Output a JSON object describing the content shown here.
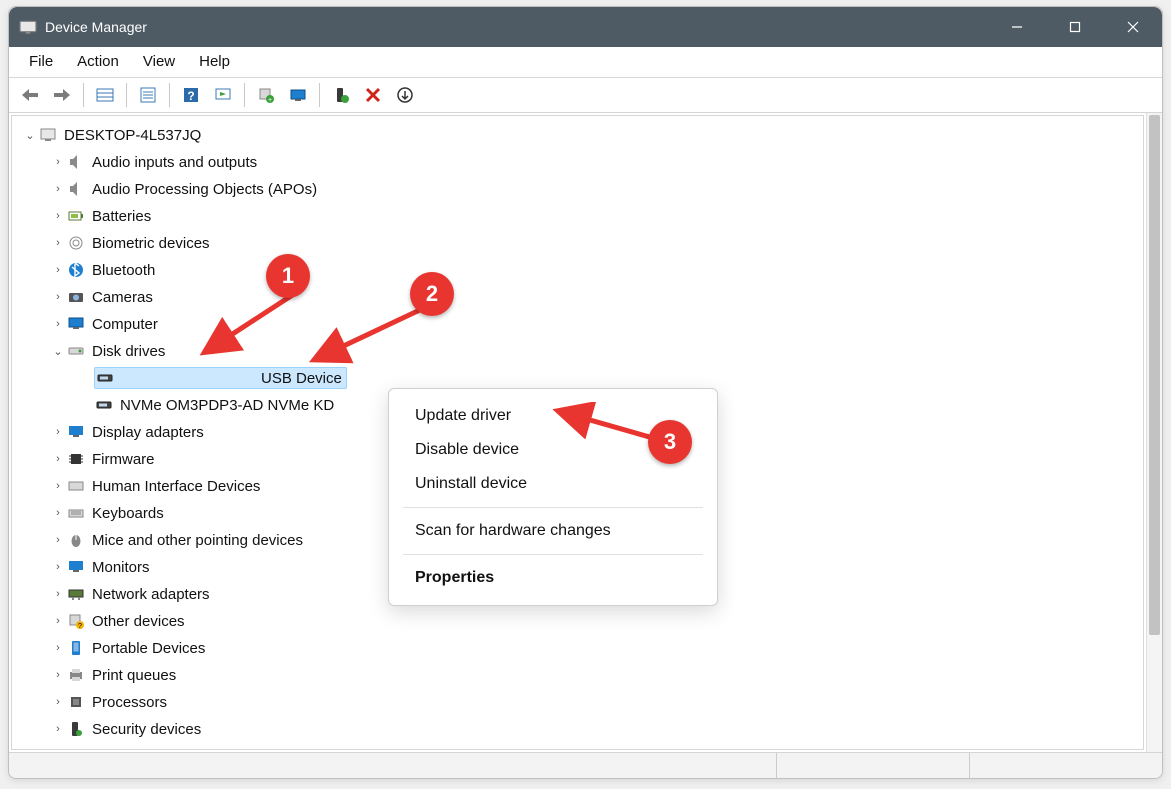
{
  "window": {
    "title": "Device Manager"
  },
  "menu": {
    "file": "File",
    "action": "Action",
    "view": "View",
    "help": "Help"
  },
  "tree": {
    "root": "DESKTOP-4L537JQ",
    "items": [
      {
        "label": "Audio inputs and outputs"
      },
      {
        "label": "Audio Processing Objects (APOs)"
      },
      {
        "label": "Batteries"
      },
      {
        "label": "Biometric devices"
      },
      {
        "label": "Bluetooth"
      },
      {
        "label": "Cameras"
      },
      {
        "label": "Computer"
      },
      {
        "label": "Disk drives",
        "expanded": true,
        "children": [
          {
            "label": "USB Device",
            "selected": true
          },
          {
            "label": "NVMe OM3PDP3-AD NVMe KD"
          }
        ]
      },
      {
        "label": "Display adapters"
      },
      {
        "label": "Firmware"
      },
      {
        "label": "Human Interface Devices"
      },
      {
        "label": "Keyboards"
      },
      {
        "label": "Mice and other pointing devices"
      },
      {
        "label": "Monitors"
      },
      {
        "label": "Network adapters"
      },
      {
        "label": "Other devices"
      },
      {
        "label": "Portable Devices"
      },
      {
        "label": "Print queues"
      },
      {
        "label": "Processors"
      },
      {
        "label": "Security devices"
      }
    ]
  },
  "context": {
    "update": "Update driver",
    "disable": "Disable device",
    "uninstall": "Uninstall device",
    "scan": "Scan for hardware changes",
    "properties": "Properties"
  },
  "annotations": [
    "1",
    "2",
    "3"
  ]
}
